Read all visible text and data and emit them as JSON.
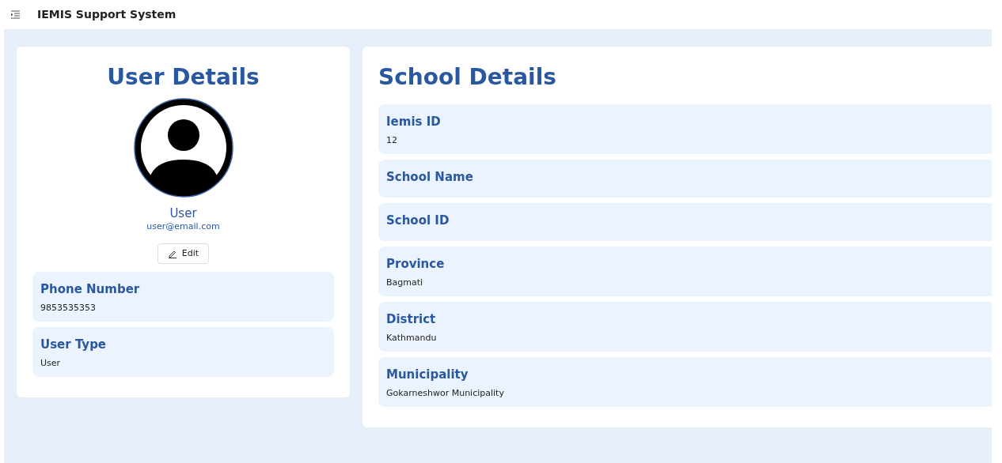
{
  "header": {
    "title": "IEMIS Support System"
  },
  "user_card": {
    "title": "User Details",
    "name": "User",
    "email": "user@email.com",
    "edit_button": "Edit",
    "fields": [
      {
        "label": "Phone Number",
        "value": "9853535353"
      },
      {
        "label": "User Type",
        "value": "User"
      }
    ]
  },
  "school_card": {
    "title": "School Details",
    "fields": [
      {
        "label": "Iemis ID",
        "value": "12"
      },
      {
        "label": "School Name"
      },
      {
        "label": "School ID"
      },
      {
        "label": "Province",
        "value": "Bagmati"
      },
      {
        "label": "District",
        "value": "Kathmandu"
      },
      {
        "label": "Municipality",
        "value": "Gokarneshwor Municipality"
      }
    ]
  }
}
